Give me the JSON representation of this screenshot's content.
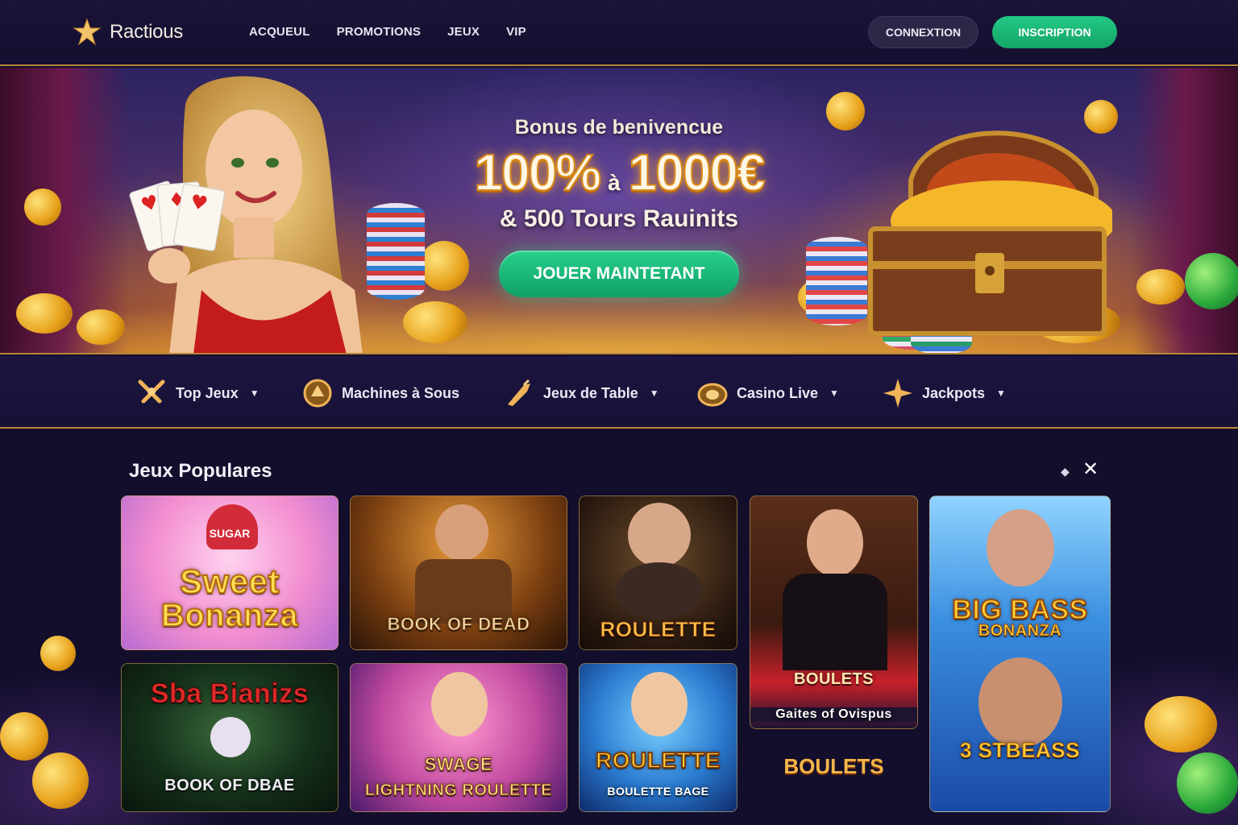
{
  "brand": {
    "name": "Ractious"
  },
  "nav": [
    "ACQUEUL",
    "PROMOTIONS",
    "JEUX",
    "VIP"
  ],
  "auth": {
    "login": "CONNEXTION",
    "signup": "INSCRIPTION"
  },
  "hero": {
    "subtitle": "Bonus de benivencue",
    "percent": "100%",
    "connector": "à",
    "amount": "1000€",
    "spins": "& 500 Tours Rauinits",
    "cta": "JOUER MAINTETANT"
  },
  "categories": [
    {
      "label": "Top Jeux",
      "dropdown": true
    },
    {
      "label": "Machines à Sous",
      "dropdown": false
    },
    {
      "label": "Jeux de Table",
      "dropdown": true
    },
    {
      "label": "Casino Live",
      "dropdown": true
    },
    {
      "label": "Jackpots",
      "dropdown": true
    }
  ],
  "popular": {
    "title": "Jeux Populares",
    "games": [
      {
        "title_line1": "Sweet",
        "title_line2": "Bonanza",
        "badge": "SUGAR"
      },
      {
        "title": "BOOK OF DEAD"
      },
      {
        "title": "ROULETTE"
      },
      {
        "title": "Gaites of Ovispus",
        "badge": "BOULETS"
      },
      {
        "title_line1": "BIG BASS",
        "title_line2": "BONANZA"
      },
      {
        "title": "BOOK OF DBAE",
        "badge": "Sba Bianizs"
      },
      {
        "title": "LIGHTNING ROULETTE",
        "badge": "SWAGE"
      },
      {
        "title": "ROULETTE",
        "subtitle": "BOULETTE BAGE"
      },
      {
        "title": "BOULETS"
      },
      {
        "title": "3 STBEASS"
      }
    ]
  },
  "colors": {
    "accent_green": "#1cb877",
    "gold_border": "#b8863a",
    "background": "#130e2c"
  }
}
